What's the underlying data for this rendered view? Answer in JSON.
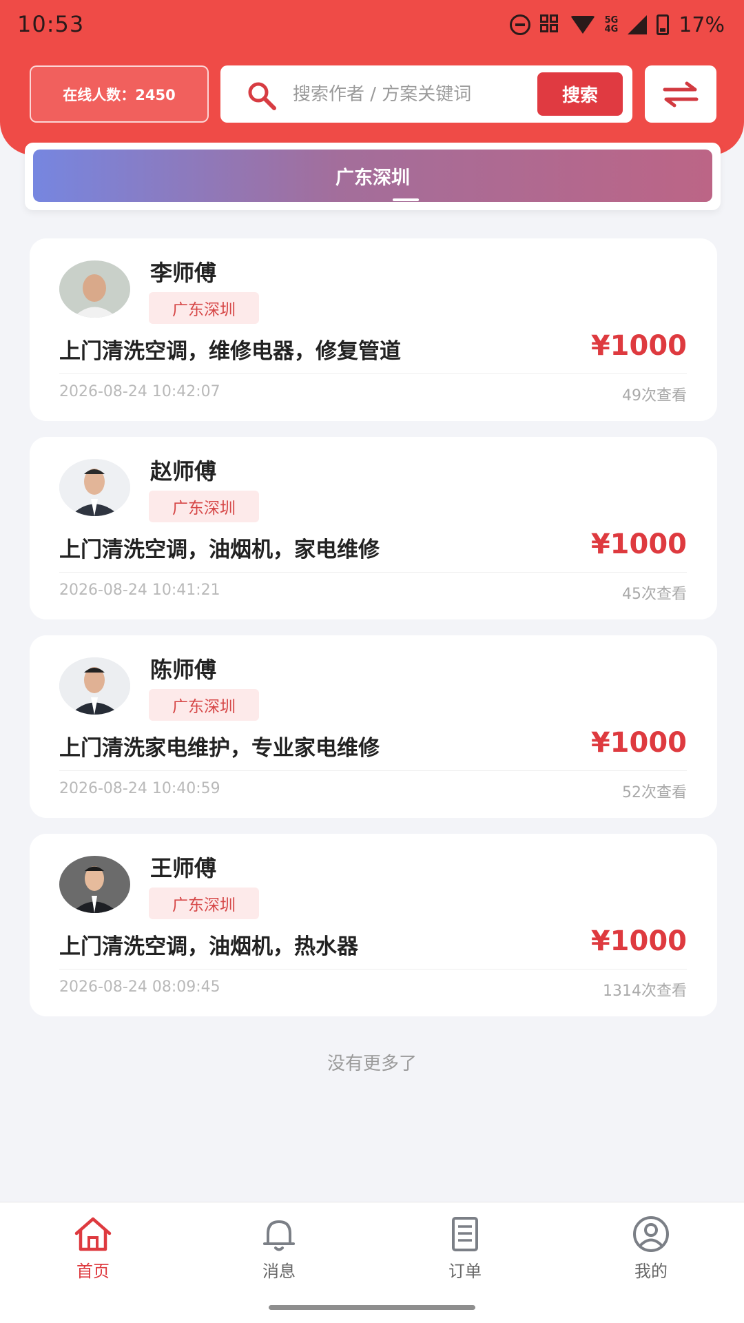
{
  "status_bar": {
    "time": "10:53",
    "network": "5G\n4G",
    "battery": "17%"
  },
  "header": {
    "online_count": "在线人数：2450",
    "search_placeholder": "搜索作者 / 方案关键词",
    "search_button": "搜索"
  },
  "region_tab": {
    "label": "广东深圳"
  },
  "listings": [
    {
      "name": "李师傅",
      "tag": "广东深圳",
      "title": "上门清洗空调，维修电器，修复管道",
      "price": "¥1000",
      "date": "2026-08-24 10:42:07",
      "views": "49次查看"
    },
    {
      "name": "赵师傅",
      "tag": "广东深圳",
      "title": "上门清洗空调，油烟机，家电维修",
      "price": "¥1000",
      "date": "2026-08-24 10:41:21",
      "views": "45次查看"
    },
    {
      "name": "陈师傅",
      "tag": "广东深圳",
      "title": "上门清洗家电维护，专业家电维修",
      "price": "¥1000",
      "date": "2026-08-24 10:40:59",
      "views": "52次查看"
    },
    {
      "name": "王师傅",
      "tag": "广东深圳",
      "title": "上门清洗空调，油烟机，热水器",
      "price": "¥1000",
      "date": "2026-08-24 08:09:45",
      "views": "1314次查看"
    }
  ],
  "no_more": "没有更多了",
  "bottom_nav": [
    {
      "label": "首页",
      "icon": "home-icon",
      "active": true
    },
    {
      "label": "消息",
      "icon": "bell-icon",
      "active": false
    },
    {
      "label": "订单",
      "icon": "document-icon",
      "active": false
    },
    {
      "label": "我的",
      "icon": "user-icon",
      "active": false
    }
  ],
  "colors": {
    "header_red": "#ef4b47",
    "price_red": "#de3a3f",
    "tag_bg": "#fdeaea",
    "tab_gradient_start": "#7686e0",
    "tab_gradient_end": "#bc6586"
  }
}
